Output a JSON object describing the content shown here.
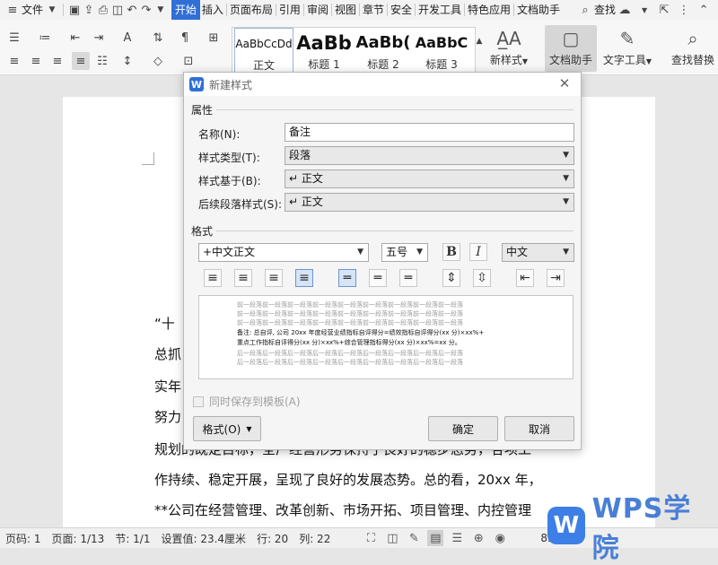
{
  "menubar": {
    "file": "文件",
    "tabs": [
      "开始",
      "插入",
      "页面布局",
      "引用",
      "审阅",
      "视图",
      "章节",
      "安全",
      "开发工具",
      "特色应用",
      "文档助手"
    ],
    "active_tab": "开始",
    "search": "查找"
  },
  "ribbon": {
    "styles": [
      {
        "sample": "AaBbCcDd",
        "name": "正文"
      },
      {
        "sample": "AaBb",
        "name": "标题 1"
      },
      {
        "sample": "AaBb(",
        "name": "标题 2"
      },
      {
        "sample": "AaBbC",
        "name": "标题 3"
      }
    ],
    "new_style": "新样式",
    "doc_assistant": "文档助手",
    "text_tools": "文字工具",
    "find_replace": "查找替换"
  },
  "document": {
    "lines": [
      "“十",
      "总抓",
      "实年",
      "努力",
      "规划的既定目标，全厂经营形势保持了良好的稳步态势，各项工",
      "作持续、稳定开展，呈现了良好的发展态势。总的看，20xx 年，",
      "**公司在经营管理、改革创新、市场开拓、项目管理、内控管理"
    ]
  },
  "dialog": {
    "title": "新建样式",
    "section_props": "属性",
    "name_label": "名称(N):",
    "name_value": "备注",
    "type_label": "样式类型(T):",
    "type_value": "段落",
    "based_label": "样式基于(B):",
    "based_value": "↵ 正文",
    "next_label": "后续段落样式(S):",
    "next_value": "↵ 正文",
    "section_format": "格式",
    "font_value": "+中文正文",
    "size_value": "五号",
    "bold": "B",
    "italic": "I",
    "lang_value": "中文",
    "preview_lines": [
      "前一段落前一段落前一段落前一段落前一段落前一段落前一段落前一段落前一段落",
      "前一段落前一段落前一段落前一段落前一段落前一段落前一段落前一段落前一段落",
      "前一段落前一段落前一段落前一段落前一段落前一段落前一段落前一段落前一段落",
      "备注: 总自评, 公司 20xx 年度经营业绩指标自评得分=绩效指标自评得分(xx 分)×xx%+",
      "重点工作指标自评得分(xx 分)×xx%+综合管理指标得分(xx 分)×xx%=xx 分。",
      "后一段落后一段落后一段落后一段落后一段落后一段落后一段落后一段落后一段落",
      "后一段落后一段落后一段落后一段落后一段落后一段落后一段落后一段落后一段落"
    ],
    "save_template": "同时保存到模板(A)",
    "format_button": "格式(O)",
    "ok": "确定",
    "cancel": "取消"
  },
  "status": {
    "page_code": "页码: 1",
    "page": "页面: 1/13",
    "section": "节: 1/1",
    "setting": "设置值: 23.4厘米",
    "row": "行: 20",
    "col": "列: 22",
    "zoom": "83%"
  },
  "watermark": {
    "logo": "W",
    "text": "WPS学院"
  },
  "colors": {
    "accent": "#2f6fd6",
    "watermark": "#4a7fd6"
  }
}
